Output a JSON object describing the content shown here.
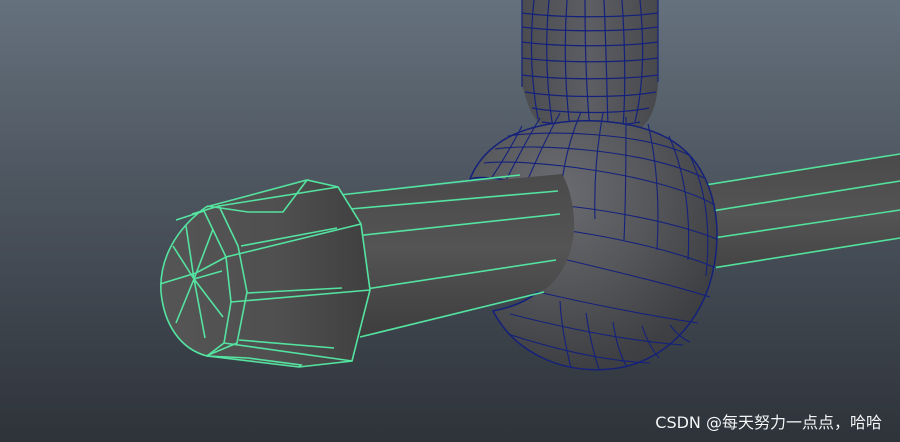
{
  "viewport": {
    "background_colors": [
      "#65717d",
      "#2e333a"
    ]
  },
  "objects": [
    {
      "name": "selected-rod-with-cap",
      "wireframe_color": "#54e3a0",
      "shade_color": "#4e4e4f"
    },
    {
      "name": "ball-joint-and-post",
      "wireframe_color": "#14217b",
      "shade_color": "#555659"
    }
  ],
  "watermark": {
    "text": "CSDN @每天努力一点点，哈哈"
  }
}
